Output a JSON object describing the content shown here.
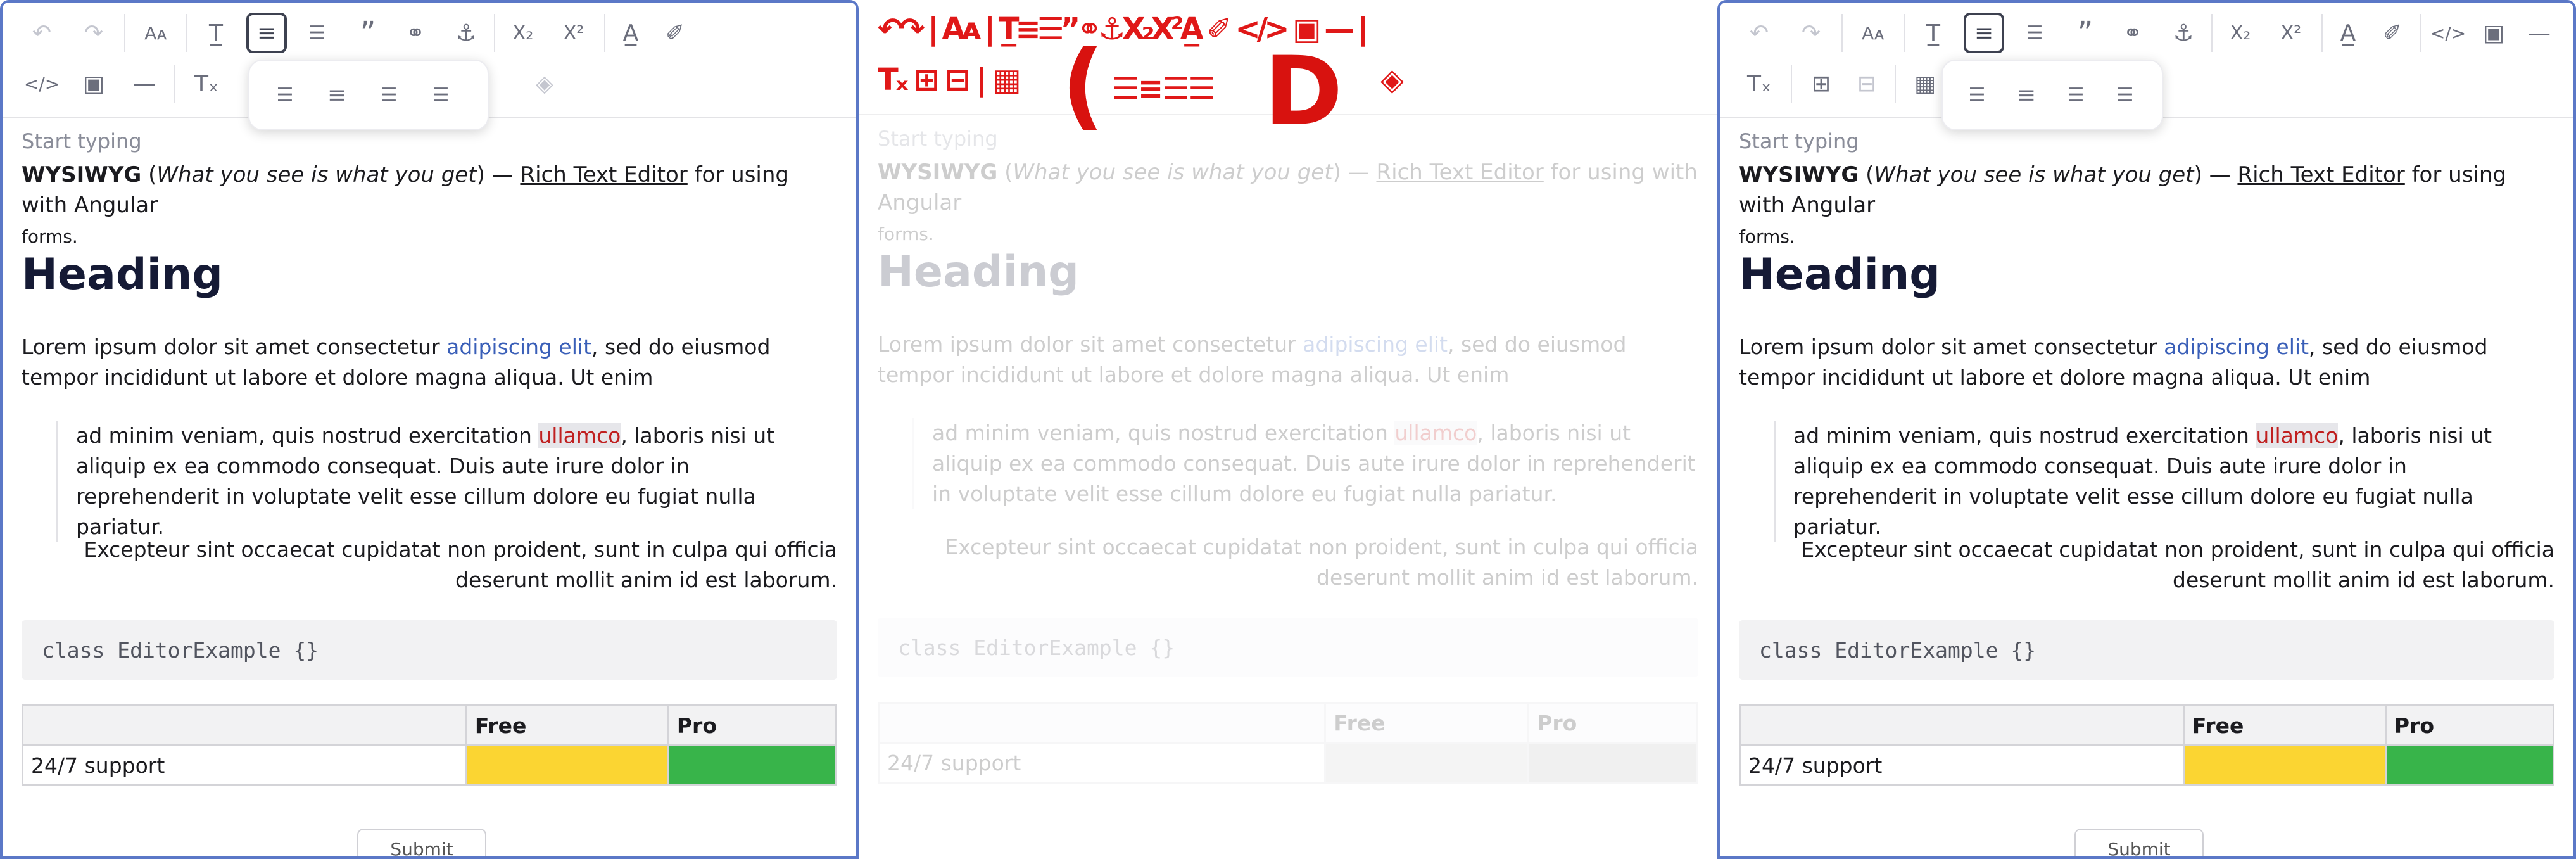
{
  "editor": {
    "placeholder": "Start typing",
    "intro": {
      "strong": "WYSIWYG",
      "paren_open": " (",
      "italic": "What you see is what you get",
      "paren_close": ") — ",
      "underline": "Rich Text Editor",
      "tail": " for using with Angular",
      "tail2": "forms."
    },
    "heading": "Heading",
    "para": {
      "before": "Lorem ipsum dolor sit amet consectetur ",
      "link": "adipiscing elit",
      "after": ", sed do eiusmod tempor incididunt ut labore et dolore magna aliqua. Ut enim"
    },
    "quote": {
      "before": "ad minim veniam, quis nostrud exercitation ",
      "highlight": "ullamco",
      "after": ", laboris nisi ut aliquip ex ea commodo consequat. Duis aute irure dolor in reprehenderit in voluptate velit esse cillum dolore eu fugiat nulla pariatur."
    },
    "right_para": "Excepteur sint occaecat cupidatat non proident, sunt in culpa qui officia deserunt mollit anim id est laborum.",
    "code": "class EditorExample {}",
    "table": {
      "headers": [
        "",
        "Free",
        "Pro"
      ],
      "rows": [
        [
          "24/7 support",
          "",
          ""
        ]
      ]
    },
    "footer_button": "Submit"
  },
  "toolbar_icons": {
    "undo": "↶",
    "redo": "↷",
    "font_size": "Aᴀ",
    "text_style": "T̲",
    "align": "≡",
    "list": "☰",
    "quote": "”",
    "link": "⚭",
    "anchor": "⚓",
    "subscript": "X₂",
    "superscript": "X²",
    "font_color": "A̲",
    "paint": "✐",
    "code": "</>",
    "image": "▣",
    "hr": "—",
    "clear": "Tₓ",
    "table": "▦",
    "fill": "◈",
    "align_left": "☰",
    "align_center": "≡",
    "align_right": "☰",
    "align_justify": "☰",
    "add_cell": "⊞",
    "remove_cell": "⊟"
  },
  "colors": {
    "accent_border": "#5b78c7",
    "link": "#3a5fb8",
    "highlight_text": "#c02020",
    "yellow_cell": "#fbd532",
    "green_cell": "#38b44a",
    "glitch_red": "#e01818"
  }
}
